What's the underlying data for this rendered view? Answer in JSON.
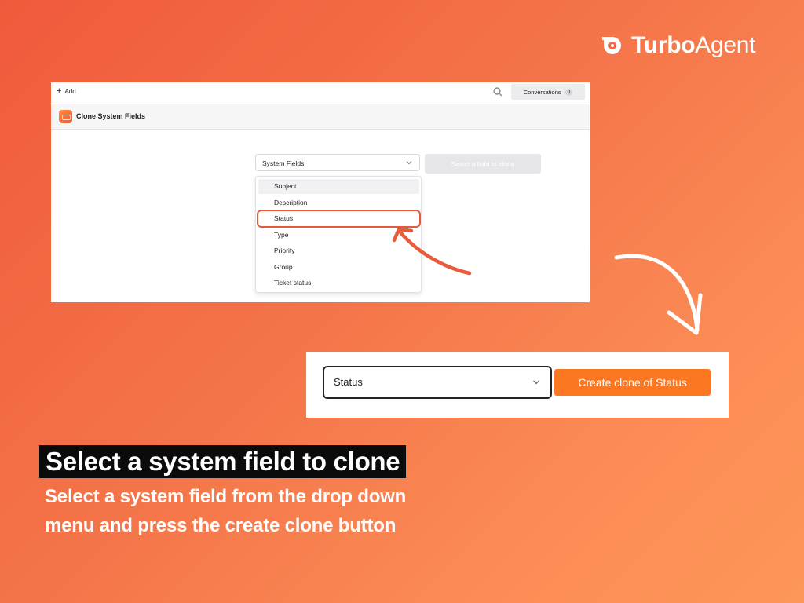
{
  "brand": {
    "name_bold": "Turbo",
    "name_regular": "Agent",
    "logo_icon": "turbo-logo-icon"
  },
  "panel1": {
    "topbar": {
      "add_label": "Add",
      "conversations_label": "Conversations",
      "conversations_count": "0"
    },
    "header": {
      "title": "Clone System Fields",
      "icon": "app-icon"
    },
    "select": {
      "value": "System Fields"
    },
    "clone_button": {
      "label": "Select a field to clone"
    },
    "menu": {
      "items": [
        {
          "label": "Subject"
        },
        {
          "label": "Description"
        },
        {
          "label": "Status"
        },
        {
          "label": "Type"
        },
        {
          "label": "Priority"
        },
        {
          "label": "Group"
        },
        {
          "label": "Ticket status"
        }
      ],
      "highlighted": "Subject",
      "selected": "Status"
    }
  },
  "panel2": {
    "select": {
      "value": "Status"
    },
    "create_button": {
      "label": "Create clone of Status"
    }
  },
  "caption": {
    "title": "Select a system field to clone",
    "description": "Select a system field from the drop down menu and press the create clone button"
  },
  "colors": {
    "accent": "#fb7722",
    "highlight_outline": "#e65a3a",
    "caption_bg": "#0b0b0b"
  }
}
